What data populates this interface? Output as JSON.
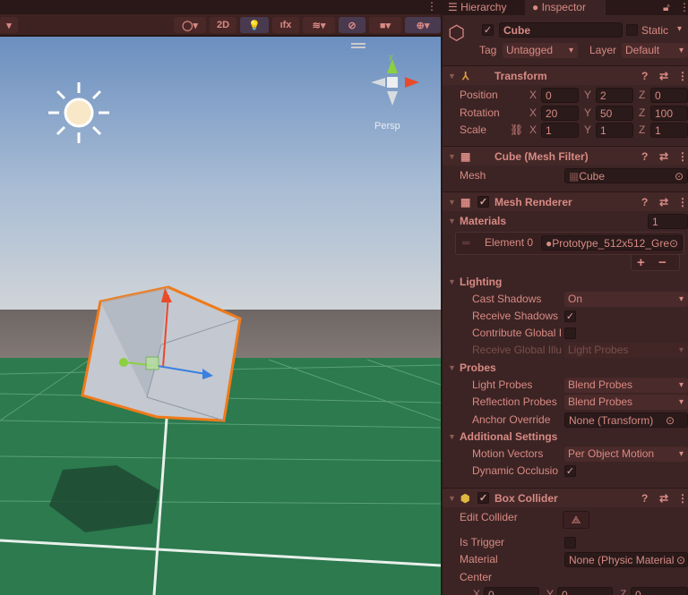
{
  "scene": {
    "toolbar": {
      "two_d": "2D"
    },
    "persp_label": "Persp",
    "gizmo_axes": {
      "x": "x",
      "y": "y",
      "z": "z"
    }
  },
  "inspector": {
    "tabs": {
      "hierarchy": "Hierarchy",
      "inspector": "Inspector"
    },
    "object": {
      "active": true,
      "name": "Cube",
      "static_label": "Static",
      "static": false,
      "tag_label": "Tag",
      "tag": "Untagged",
      "layer_label": "Layer",
      "layer": "Default"
    },
    "transform": {
      "title": "Transform",
      "position_label": "Position",
      "rotation_label": "Rotation",
      "scale_label": "Scale",
      "position": {
        "x": "0",
        "y": "2",
        "z": "0"
      },
      "rotation": {
        "x": "20",
        "y": "50",
        "z": "100"
      },
      "scale": {
        "x": "1",
        "y": "1",
        "z": "1"
      }
    },
    "mesh_filter": {
      "title": "Cube (Mesh Filter)",
      "mesh_label": "Mesh",
      "mesh": "Cube"
    },
    "mesh_renderer": {
      "title": "Mesh Renderer",
      "enabled": true,
      "materials_label": "Materials",
      "materials_count": "1",
      "element0_label": "Element 0",
      "element0": "Prototype_512x512_Gre",
      "lighting_label": "Lighting",
      "cast_shadows_label": "Cast Shadows",
      "cast_shadows": "On",
      "receive_shadows_label": "Receive Shadows",
      "receive_shadows": true,
      "contribute_gi_label": "Contribute Global I",
      "contribute_gi": false,
      "receive_gi_label": "Receive Global Illu",
      "receive_gi": "Light Probes",
      "probes_label": "Probes",
      "light_probes_label": "Light Probes",
      "light_probes": "Blend Probes",
      "reflection_probes_label": "Reflection Probes",
      "reflection_probes": "Blend Probes",
      "anchor_override_label": "Anchor Override",
      "anchor_override": "None (Transform)",
      "additional_label": "Additional Settings",
      "motion_vectors_label": "Motion Vectors",
      "motion_vectors": "Per Object Motion",
      "dynamic_occlusion_label": "Dynamic Occlusio",
      "dynamic_occlusion": true
    },
    "box_collider": {
      "title": "Box Collider",
      "enabled": true,
      "edit_collider_label": "Edit Collider",
      "is_trigger_label": "Is Trigger",
      "is_trigger": false,
      "material_label": "Material",
      "material": "None (Physic Material",
      "center_label": "Center",
      "center": {
        "x": "0",
        "y": "0",
        "z": "0"
      }
    }
  },
  "axis_letters": {
    "x": "X",
    "y": "Y",
    "z": "Z"
  },
  "buttons": {
    "plus": "+",
    "minus": "−"
  },
  "colors": {
    "accent_selection": "#f07a1a",
    "ground": "#2c7a4e",
    "sky": "#6b8fc0"
  }
}
